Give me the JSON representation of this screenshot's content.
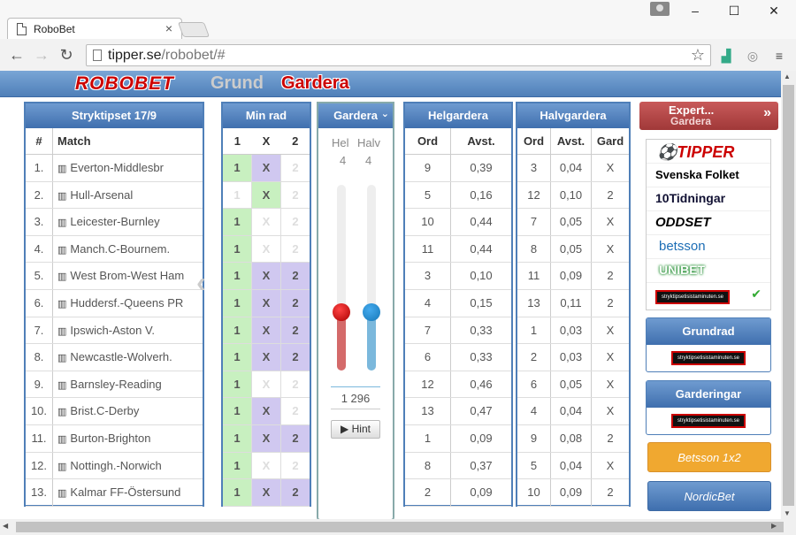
{
  "browser": {
    "tab_title": "RoboBet",
    "url_host": "tipper.se",
    "url_path": "/robobet/#"
  },
  "app": {
    "logo": "ROBOBET",
    "nav_grund": "Grund",
    "nav_gardera": "Gardera"
  },
  "matches": {
    "title": "Stryktipset 17/9",
    "col_num": "#",
    "col_match": "Match",
    "rows": [
      {
        "n": "1.",
        "m": "Everton-Middlesbr"
      },
      {
        "n": "2.",
        "m": "Hull-Arsenal"
      },
      {
        "n": "3.",
        "m": "Leicester-Burnley"
      },
      {
        "n": "4.",
        "m": "Manch.C-Bournem."
      },
      {
        "n": "5.",
        "m": "West Brom-West Ham"
      },
      {
        "n": "6.",
        "m": "Huddersf.-Queens PR"
      },
      {
        "n": "7.",
        "m": "Ipswich-Aston V."
      },
      {
        "n": "8.",
        "m": "Newcastle-Wolverh."
      },
      {
        "n": "9.",
        "m": "Barnsley-Reading"
      },
      {
        "n": "10.",
        "m": "Brist.C-Derby"
      },
      {
        "n": "11.",
        "m": "Burton-Brighton"
      },
      {
        "n": "12.",
        "m": "Nottingh.-Norwich"
      },
      {
        "n": "13.",
        "m": "Kalmar FF-Östersund"
      }
    ]
  },
  "minrad": {
    "title": "Min rad",
    "h1": "1",
    "hx": "X",
    "h2": "2",
    "rows": [
      {
        "a": "1",
        "x": "X",
        "b": "2"
      },
      {
        "a": "1",
        "x": "X",
        "b": "2"
      },
      {
        "a": "1",
        "x": "X",
        "b": "2"
      },
      {
        "a": "1",
        "x": "X",
        "b": "2"
      },
      {
        "a": "1",
        "x": "X",
        "b": "2"
      },
      {
        "a": "1",
        "x": "X",
        "b": "2"
      },
      {
        "a": "1",
        "x": "X",
        "b": "2"
      },
      {
        "a": "1",
        "x": "X",
        "b": "2"
      },
      {
        "a": "1",
        "x": "X",
        "b": "2"
      },
      {
        "a": "1",
        "x": "X",
        "b": "2"
      },
      {
        "a": "1",
        "x": "X",
        "b": "2"
      },
      {
        "a": "1",
        "x": "X",
        "b": "2"
      },
      {
        "a": "1",
        "x": "X",
        "b": "2"
      }
    ]
  },
  "gardera": {
    "title": "Gardera",
    "hel_label": "Hel",
    "halv_label": "Halv",
    "hel_count": "4",
    "halv_count": "4",
    "rows_total": "1 296",
    "hint_label": "Hint",
    "hel_level": 0.25,
    "halv_level": 0.25
  },
  "helgardera": {
    "title": "Helgardera",
    "col_ord": "Ord",
    "col_avst": "Avst.",
    "rows": [
      {
        "o": "9",
        "a": "0,39"
      },
      {
        "o": "5",
        "a": "0,16"
      },
      {
        "o": "10",
        "a": "0,44"
      },
      {
        "o": "11",
        "a": "0,44"
      },
      {
        "o": "3",
        "a": "0,10"
      },
      {
        "o": "4",
        "a": "0,15"
      },
      {
        "o": "7",
        "a": "0,33"
      },
      {
        "o": "6",
        "a": "0,33"
      },
      {
        "o": "12",
        "a": "0,46"
      },
      {
        "o": "13",
        "a": "0,47"
      },
      {
        "o": "1",
        "a": "0,09"
      },
      {
        "o": "8",
        "a": "0,37"
      },
      {
        "o": "2",
        "a": "0,09"
      }
    ]
  },
  "halvgardera": {
    "title": "Halvgardera",
    "col_ord": "Ord",
    "col_avst": "Avst.",
    "col_gard": "Gard",
    "rows": [
      {
        "o": "3",
        "a": "0,04",
        "g": "X"
      },
      {
        "o": "12",
        "a": "0,10",
        "g": "2"
      },
      {
        "o": "7",
        "a": "0,05",
        "g": "X"
      },
      {
        "o": "8",
        "a": "0,05",
        "g": "X"
      },
      {
        "o": "11",
        "a": "0,09",
        "g": "2"
      },
      {
        "o": "13",
        "a": "0,11",
        "g": "2"
      },
      {
        "o": "1",
        "a": "0,03",
        "g": "X"
      },
      {
        "o": "2",
        "a": "0,03",
        "g": "X"
      },
      {
        "o": "6",
        "a": "0,05",
        "g": "X"
      },
      {
        "o": "4",
        "a": "0,04",
        "g": "X"
      },
      {
        "o": "9",
        "a": "0,08",
        "g": "2"
      },
      {
        "o": "5",
        "a": "0,04",
        "g": "X"
      },
      {
        "o": "10",
        "a": "0,09",
        "g": "2"
      }
    ]
  },
  "expert": {
    "title_line1": "Expert...",
    "title_line2": "Gardera",
    "sources": [
      "TIPPER",
      "Svenska Folket",
      "10Tidningar",
      "ODDSET",
      "betsson",
      "UNIBET",
      "stryktipsetisistaminuten.se"
    ]
  },
  "grundrad": {
    "title": "Grundrad",
    "sponsor": "stryktipsetisistaminuten.se"
  },
  "garderingar": {
    "title": "Garderingar",
    "sponsor": "stryktipsetisistaminuten.se"
  },
  "betsson_btn": "Betsson 1x2",
  "nordicbet_btn": "NordicBet",
  "colors": {
    "header_blue": "#4f7fb8",
    "green_cell": "#c8f0c0",
    "purple_cell": "#d0c8f0",
    "red": "#cc0000",
    "orange": "#f0a830"
  }
}
